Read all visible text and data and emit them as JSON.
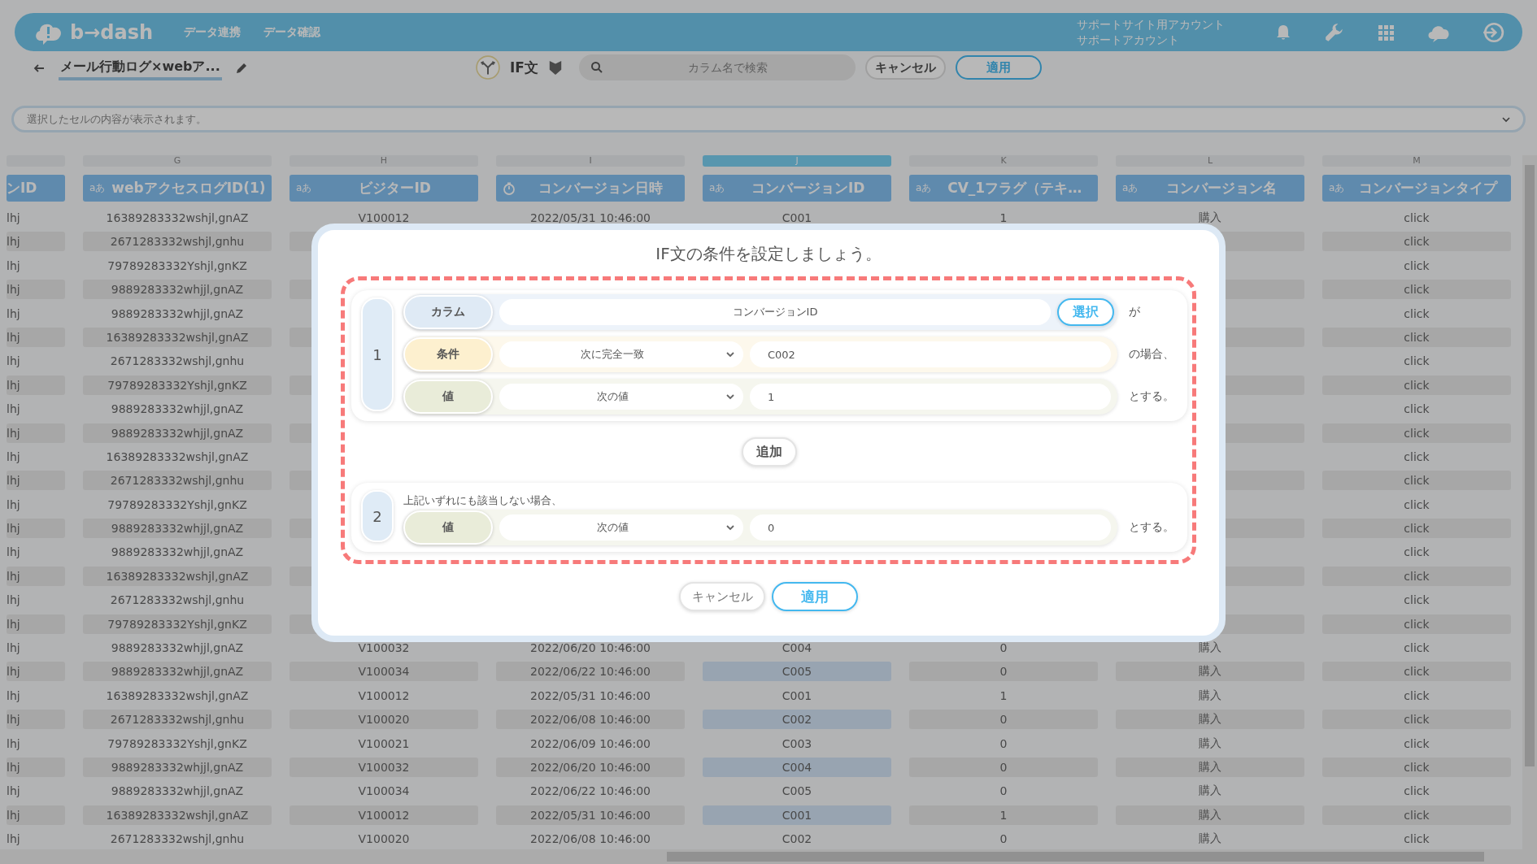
{
  "top_bar": {
    "logo": "b→dash",
    "nav": [
      "データ連携",
      "データ確認"
    ],
    "account_site": "サポートサイト用アカウント",
    "account_name": "サポートアカウント"
  },
  "toolbar": {
    "title": "メール行動ログ×webア...",
    "mode": "IF文",
    "search": {
      "placeholder": "カラム名で検索"
    },
    "cancel": "キャンセル",
    "apply": "適用"
  },
  "cell_bar": {
    "placeholder": "選択したセルの内容が表示されます。"
  },
  "columns": [
    {
      "title": "ンID",
      "kind": "text",
      "selected": false
    },
    {
      "letter": "G",
      "title": "webアクセスログID(1)",
      "kind": "text",
      "type_icon": "aあ",
      "selected": false
    },
    {
      "letter": "H",
      "title": "ビジターID",
      "kind": "text",
      "type_icon": "aあ",
      "selected": false
    },
    {
      "letter": "I",
      "title": "コンバージョン日時",
      "kind": "datetime",
      "selected": false
    },
    {
      "letter": "J",
      "title": "コンバージョンID",
      "kind": "text",
      "type_icon": "aあ",
      "selected": true
    },
    {
      "letter": "K",
      "title": "CV_1フラグ（テキ…",
      "kind": "text",
      "type_icon": "aあ",
      "selected": false
    },
    {
      "letter": "L",
      "title": "コンバージョン名",
      "kind": "text",
      "type_icon": "aあ",
      "selected": false
    },
    {
      "letter": "M",
      "title": "コンバージョンタイプ",
      "kind": "text",
      "type_icon": "aあ",
      "selected": false
    }
  ],
  "rows": [
    {
      "kind": "full",
      "cells": [
        "lhj",
        "16389283332wshjl,gnAZ",
        "V100012",
        "2022/05/31 10:46:00",
        "C001",
        "1",
        "購入",
        "click"
      ]
    },
    {
      "kind": "behind_dialog",
      "cells": [
        "lhj",
        "2671283332wshjl,gnhu",
        "click"
      ]
    },
    {
      "kind": "behind_dialog",
      "cells": [
        "lhj",
        "79789283332Yshjl,gnKZ",
        "click"
      ]
    },
    {
      "kind": "behind_dialog",
      "cells": [
        "lhj",
        "9889283332whjjl,gnAZ",
        "click"
      ]
    },
    {
      "kind": "behind_dialog",
      "cells": [
        "lhj",
        "9889283332whjjl,gnAZ",
        "click"
      ]
    },
    {
      "kind": "behind_dialog",
      "cells": [
        "lhj",
        "16389283332wshjl,gnAZ",
        "click"
      ]
    },
    {
      "kind": "behind_dialog",
      "cells": [
        "lhj",
        "2671283332wshjl,gnhu",
        "click"
      ]
    },
    {
      "kind": "behind_dialog",
      "cells": [
        "lhj",
        "79789283332Yshjl,gnKZ",
        "click"
      ]
    },
    {
      "kind": "behind_dialog",
      "cells": [
        "lhj",
        "9889283332whjjl,gnAZ",
        "click"
      ]
    },
    {
      "kind": "behind_dialog",
      "cells": [
        "lhj",
        "9889283332whjjl,gnAZ",
        "click"
      ]
    },
    {
      "kind": "behind_dialog",
      "cells": [
        "lhj",
        "16389283332wshjl,gnAZ",
        "click"
      ]
    },
    {
      "kind": "behind_dialog",
      "cells": [
        "lhj",
        "2671283332wshjl,gnhu",
        "click"
      ]
    },
    {
      "kind": "behind_dialog",
      "cells": [
        "lhj",
        "79789283332Yshjl,gnKZ",
        "click"
      ]
    },
    {
      "kind": "behind_dialog",
      "cells": [
        "lhj",
        "9889283332whjjl,gnAZ",
        "click"
      ]
    },
    {
      "kind": "behind_dialog",
      "cells": [
        "lhj",
        "9889283332whjjl,gnAZ",
        "click"
      ]
    },
    {
      "kind": "behind_dialog",
      "cells": [
        "lhj",
        "16389283332wshjl,gnAZ",
        "click"
      ]
    },
    {
      "kind": "behind_dialog",
      "cells": [
        "lhj",
        "2671283332wshjl,gnhu",
        "click"
      ]
    },
    {
      "kind": "behind_dialog",
      "cells": [
        "lhj",
        "79789283332Yshjl,gnKZ",
        "click"
      ]
    },
    {
      "kind": "full",
      "cells": [
        "lhj",
        "9889283332whjjl,gnAZ",
        "V100032",
        "2022/06/20 10:46:00",
        "C004",
        "0",
        "購入",
        "click"
      ]
    },
    {
      "kind": "full",
      "cells": [
        "lhj",
        "9889283332whjjl,gnAZ",
        "V100034",
        "2022/06/22 10:46:00",
        "C005",
        "0",
        "購入",
        "click"
      ]
    },
    {
      "kind": "full",
      "cells": [
        "lhj",
        "16389283332wshjl,gnAZ",
        "V100012",
        "2022/05/31 10:46:00",
        "C001",
        "1",
        "購入",
        "click"
      ]
    },
    {
      "kind": "full",
      "cells": [
        "lhj",
        "2671283332wshjl,gnhu",
        "V100020",
        "2022/06/08 10:46:00",
        "C002",
        "0",
        "購入",
        "click"
      ]
    },
    {
      "kind": "full",
      "cells": [
        "lhj",
        "79789283332Yshjl,gnKZ",
        "V100021",
        "2022/06/09 10:46:00",
        "C003",
        "0",
        "購入",
        "click"
      ]
    },
    {
      "kind": "full",
      "cells": [
        "lhj",
        "9889283332whjjl,gnAZ",
        "V100032",
        "2022/06/20 10:46:00",
        "C004",
        "0",
        "購入",
        "click"
      ]
    },
    {
      "kind": "full",
      "cells": [
        "lhj",
        "9889283332whjjl,gnAZ",
        "V100034",
        "2022/06/22 10:46:00",
        "C005",
        "0",
        "購入",
        "click"
      ]
    },
    {
      "kind": "full",
      "cells": [
        "lhj",
        "16389283332wshjl,gnAZ",
        "V100012",
        "2022/05/31 10:46:00",
        "C001",
        "1",
        "購入",
        "click"
      ]
    },
    {
      "kind": "full",
      "cells": [
        "lhj",
        "2671283332wshjl,gnhu",
        "V100020",
        "2022/06/08 10:46:00",
        "C002",
        "0",
        "購入",
        "click"
      ]
    }
  ],
  "dialog": {
    "title": "IF文の条件を設定しましょう。",
    "blocks": [
      {
        "number": "1",
        "rows": [
          {
            "kind": "column",
            "label": "カラム",
            "value": "コンバージョンID",
            "button": "選択",
            "suffix": "が"
          },
          {
            "kind": "condition",
            "label": "条件",
            "select": "次に完全一致",
            "value": "C002",
            "suffix": "の場合、"
          },
          {
            "kind": "value",
            "label": "値",
            "select": "次の値",
            "value": "1",
            "suffix": "とする。"
          }
        ]
      },
      {
        "number": "2",
        "note": "上記いずれにも該当しない場合、",
        "rows": [
          {
            "kind": "value",
            "label": "値",
            "select": "次の値",
            "value": "0",
            "suffix": "とする。"
          }
        ]
      }
    ],
    "add_button": "追加",
    "cancel": "キャンセル",
    "apply": "適用"
  }
}
